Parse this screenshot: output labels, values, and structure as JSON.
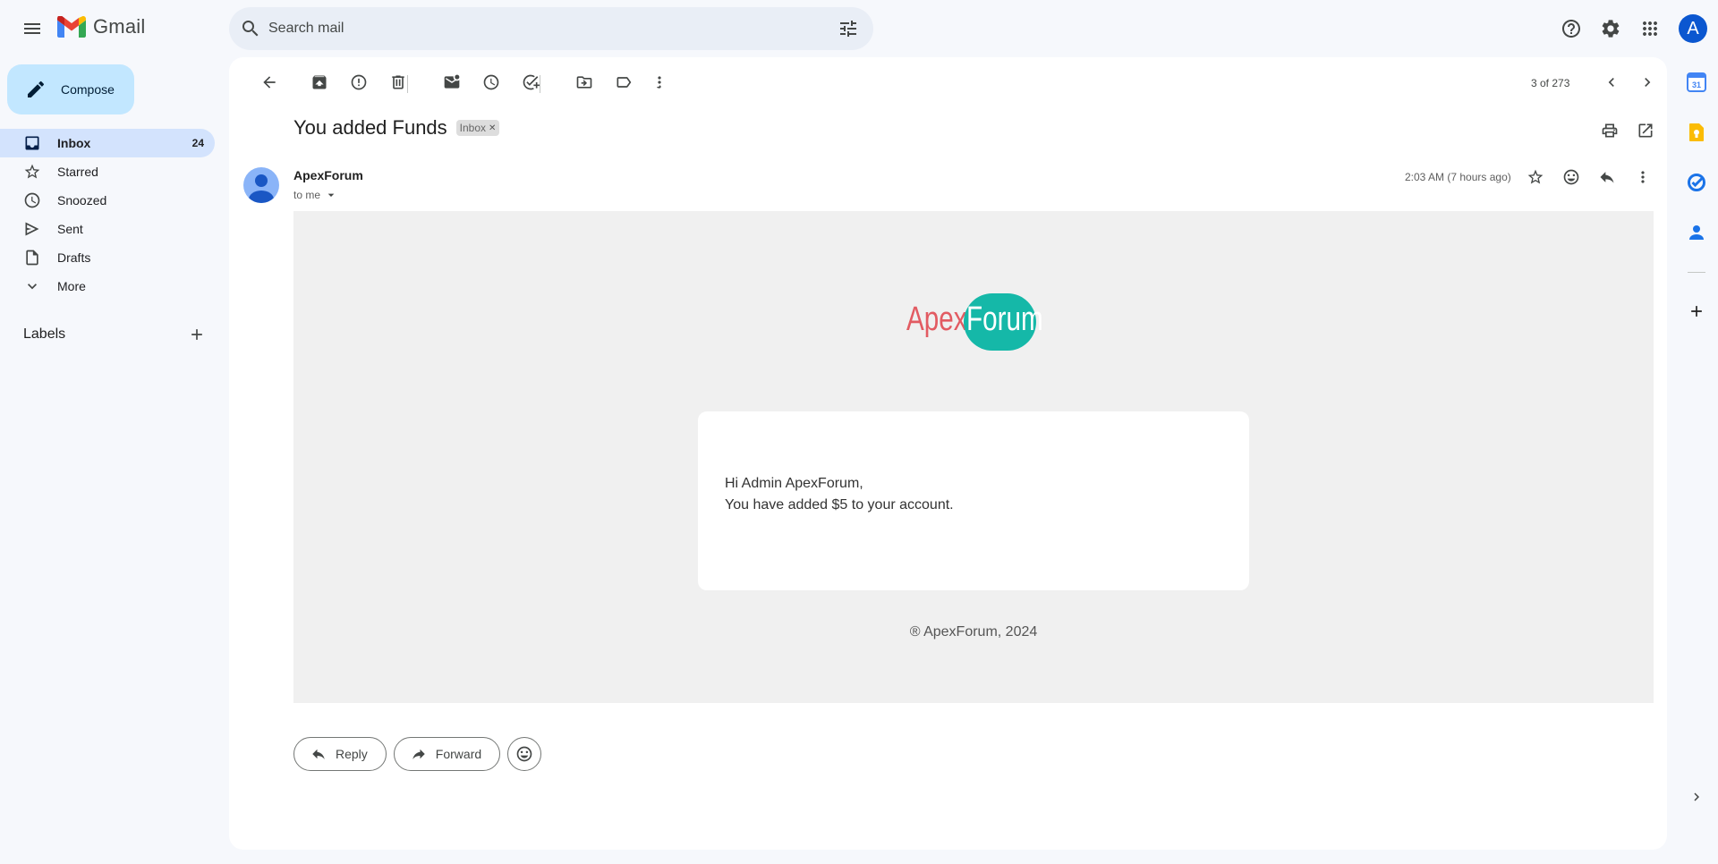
{
  "header": {
    "app_name": "Gmail",
    "search_placeholder": "Search mail",
    "avatar_letter": "A"
  },
  "sidebar": {
    "compose_label": "Compose",
    "items": [
      {
        "label": "Inbox",
        "count": "24",
        "icon": "inbox-icon"
      },
      {
        "label": "Starred",
        "count": "",
        "icon": "star-icon"
      },
      {
        "label": "Snoozed",
        "count": "",
        "icon": "clock-icon"
      },
      {
        "label": "Sent",
        "count": "",
        "icon": "send-icon"
      },
      {
        "label": "Drafts",
        "count": "",
        "icon": "draft-icon"
      },
      {
        "label": "More",
        "count": "",
        "icon": "chevron-down-icon"
      }
    ],
    "labels_title": "Labels"
  },
  "toolbar": {
    "pager": "3 of 273"
  },
  "message": {
    "subject": "You added Funds",
    "chip": "Inbox",
    "sender": "ApexForum",
    "to": "to me",
    "time": "2:03 AM (7 hours ago)"
  },
  "email": {
    "brand_part1": "Apex",
    "brand_part2": "Forum",
    "greeting": "Hi Admin ApexForum,",
    "body_line": "You have added $5 to your account.",
    "footer": "® ApexForum, 2024"
  },
  "reply": {
    "reply_label": "Reply",
    "forward_label": "Forward"
  },
  "colors": {
    "accent": "#0b57d0",
    "compose_bg": "#c2e7ff",
    "active_nav": "#d3e3fd",
    "brand_red": "#e25b62",
    "brand_teal": "#15b8a8"
  }
}
